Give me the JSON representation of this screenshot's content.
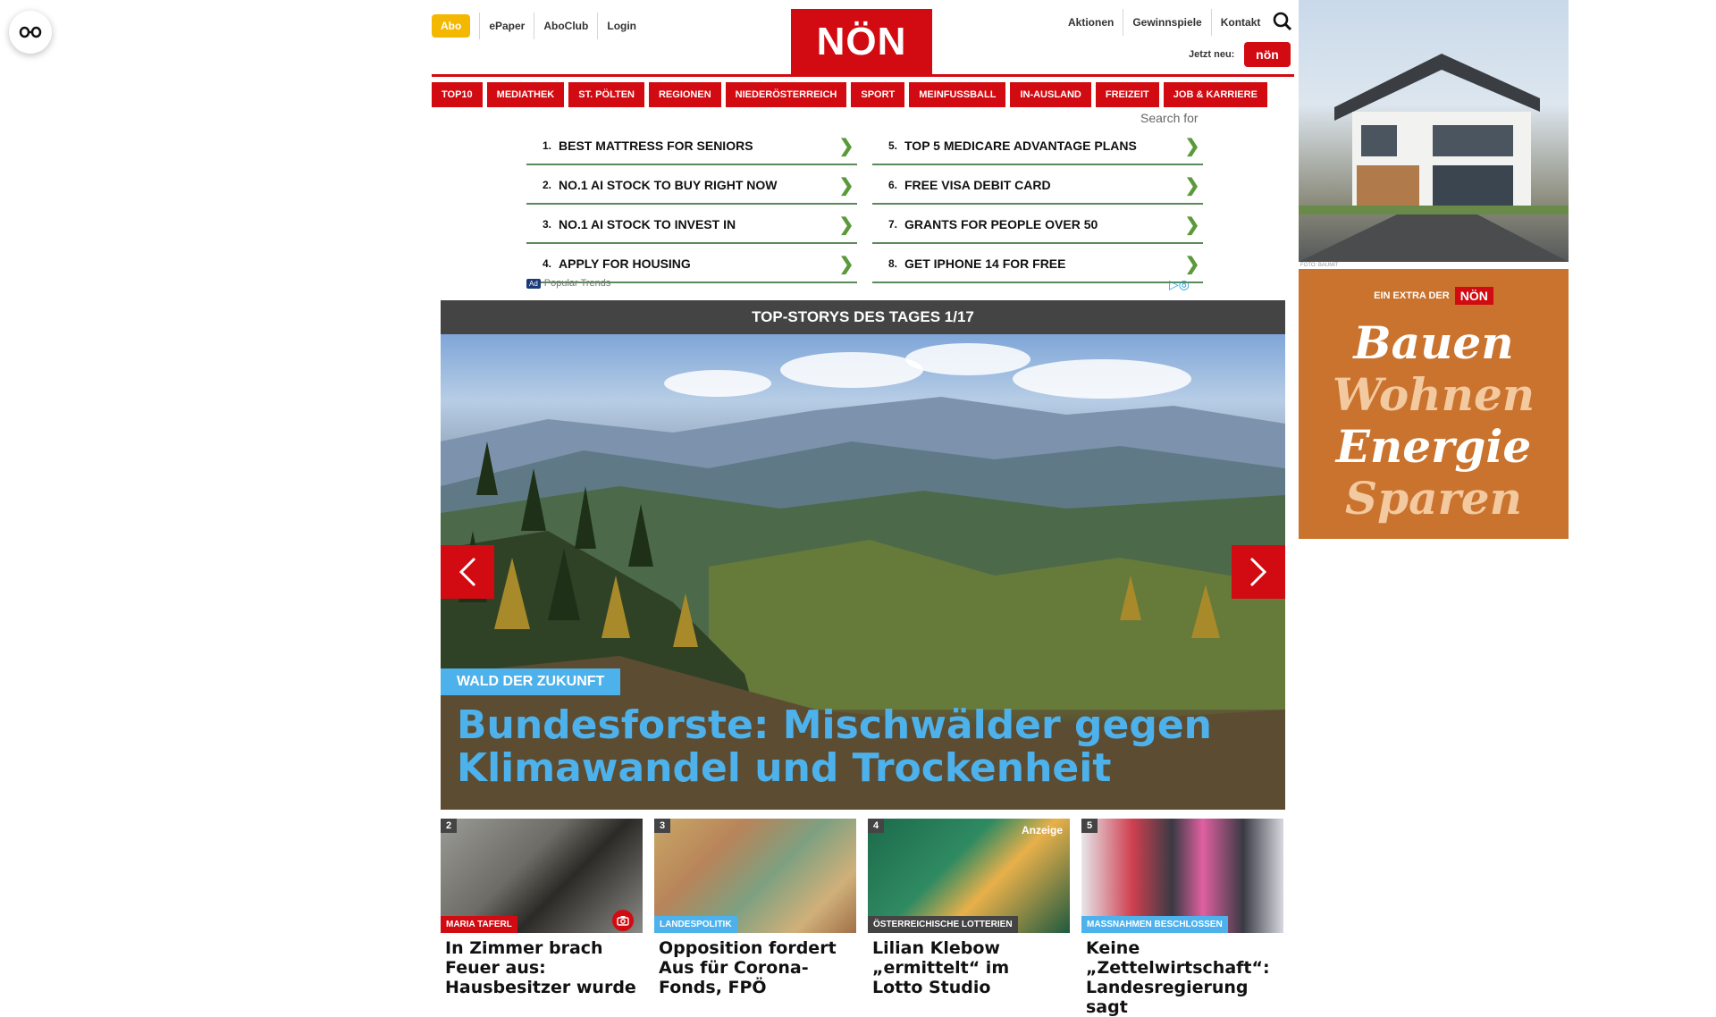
{
  "header": {
    "abo_label": "Abo",
    "left_links": [
      "ePaper",
      "AboClub",
      "Login"
    ],
    "logo_text": "NÖN",
    "right_links": [
      "Aktionen",
      "Gewinnspiele",
      "Kontakt"
    ],
    "jetzt_neu": "Jetzt neu:",
    "jetzt_badge": "nön"
  },
  "nav": {
    "items": [
      "TOP10",
      "MEDIATHEK",
      "ST. PÖLTEN",
      "REGIONEN",
      "NIEDERÖSTERREICH",
      "SPORT",
      "MEINFUSSBALL",
      "IN-AUSLAND",
      "FREIZEIT",
      "JOB & KARRIERE"
    ]
  },
  "ad_search": {
    "search_for": "Search for",
    "left": [
      {
        "num": "1.",
        "text": "BEST MATTRESS FOR SENIORS"
      },
      {
        "num": "2.",
        "text": "NO.1 AI STOCK TO BUY RIGHT NOW"
      },
      {
        "num": "3.",
        "text": "NO.1 AI STOCK TO INVEST IN"
      },
      {
        "num": "4.",
        "text": "APPLY FOR HOUSING"
      }
    ],
    "right": [
      {
        "num": "5.",
        "text": "TOP 5 MEDICARE ADVANTAGE PLANS"
      },
      {
        "num": "6.",
        "text": "FREE VISA DEBIT CARD"
      },
      {
        "num": "7.",
        "text": "GRANTS FOR PEOPLE OVER 50"
      },
      {
        "num": "8.",
        "text": "GET IPHONE 14 FOR FREE"
      }
    ],
    "ad_chip": "Ad",
    "footer_label": "Popular Trends"
  },
  "top_stories": {
    "header": "TOP-STORYS DES TAGES 1/17",
    "hero_tag": "WALD DER ZUKUNFT",
    "hero_title": "Bundesforste: Mischwälder gegen Klimawandel und Trockenheit"
  },
  "teasers": [
    {
      "idx": "2",
      "category": "MARIA TAFERL",
      "cat_color": "#d20a11",
      "title": "In Zimmer brach Feuer aus: Hausbesitzer wurde",
      "has_camera": true
    },
    {
      "idx": "3",
      "category": "LANDESPOLITIK",
      "cat_color": "#4db2ec",
      "title": "Opposition fordert Aus für Corona-Fonds, FPÖ"
    },
    {
      "idx": "4",
      "category": "ÖSTERREICHISCHE LOTTERIEN",
      "cat_color": "#444444",
      "title": "Lilian Klebow „ermittelt“ im Lotto Studio",
      "anzeige": "Anzeige"
    },
    {
      "idx": "5",
      "category": "MASSNAHMEN BESCHLOSSEN",
      "cat_color": "#4db2ec",
      "title": "Keine „Zettelwirtschaft“: Landesregierung sagt"
    }
  ],
  "ads": {
    "house_credit": "FOTO: BAUMIT",
    "bauen_extra": "EIN EXTRA DER",
    "bauen_brand": "NÖN",
    "bauen_words": [
      "Bauen",
      "Wohnen",
      "Energie",
      "Sparen"
    ]
  },
  "colors": {
    "brand_red": "#d20a11",
    "accent_blue": "#4db2ec",
    "abo_yellow": "#f5b800"
  }
}
